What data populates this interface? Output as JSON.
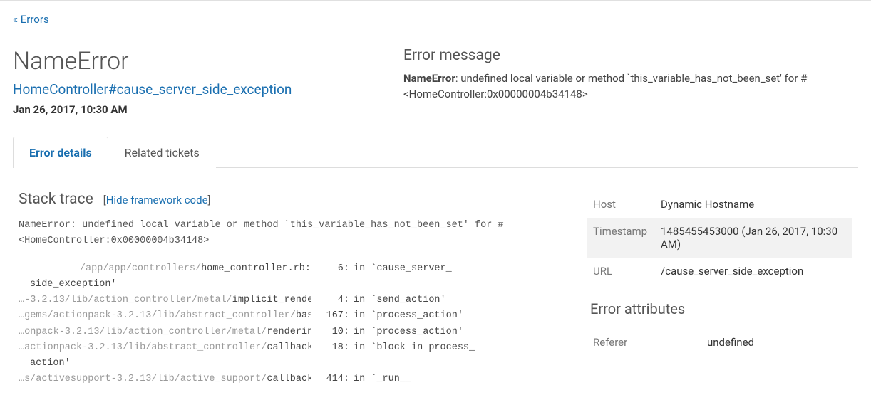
{
  "back_link": "« Errors",
  "header": {
    "title": "NameError",
    "subtitle": "HomeController#cause_server_side_exception",
    "timestamp": "Jan 26, 2017, 10:30 AM",
    "error_message_title": "Error message",
    "error_message_label": "NameError",
    "error_message_body": ": undefined local variable or method `this_variable_has_not_been_set' for #<HomeController:0x00000004b34148>"
  },
  "tabs": {
    "details": "Error details",
    "related": "Related tickets"
  },
  "stack": {
    "title": "Stack trace",
    "hide_pre": "[",
    "hide_link": "Hide framework code",
    "hide_post": "]",
    "head": "NameError: undefined local variable or method `this_variable_has_not_been_set' for #<HomeController:0x00000004b34148>",
    "rows": [
      {
        "path_dim": "/app/app/controllers/",
        "path_hl": "home_controller.rb:",
        "line": "6:",
        "rest": "in `cause_server_",
        "rest2": "side_exception'"
      },
      {
        "path_dim": "…-3.2.13/lib/action_controller/metal/",
        "path_hl": "implicit_render.rb:",
        "line": "4:",
        "rest": "in `send_action'"
      },
      {
        "path_dim": "…gems/actionpack-3.2.13/lib/abstract_controller/",
        "path_hl": "base.rb:",
        "line": "167:",
        "rest": "in `process_action'"
      },
      {
        "path_dim": "…onpack-3.2.13/lib/action_controller/metal/",
        "path_hl": "rendering.rb:",
        "line": "10:",
        "rest": "in `process_action'"
      },
      {
        "path_dim": "…actionpack-3.2.13/lib/abstract_controller/",
        "path_hl": "callbacks.rb:",
        "line": "18:",
        "rest": "in `block in process_",
        "rest2": "action'"
      },
      {
        "path_dim": "…s/activesupport-3.2.13/lib/active_support/",
        "path_hl": "callbacks.rb:",
        "line": "414:",
        "rest": "in `_run__"
      }
    ]
  },
  "attrs": {
    "host_k": "Host",
    "host_v": "Dynamic Hostname",
    "ts_k": "Timestamp",
    "ts_v": "1485455453000 (Jan 26, 2017, 10:30 AM)",
    "url_k": "URL",
    "url_v": "/cause_server_side_exception",
    "section": "Error attributes",
    "ref_k": "Referer",
    "ref_v": "undefined"
  }
}
